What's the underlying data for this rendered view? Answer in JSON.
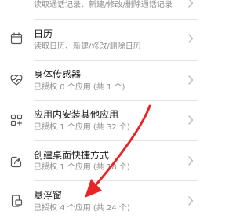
{
  "permissions": {
    "items": [
      {
        "title": "",
        "subtitle": "读取通话记录、新建/修改/删除通话记录",
        "icon": "call-log-icon"
      },
      {
        "title": "日历",
        "subtitle": "读取日历、新建/修改/删除日历",
        "icon": "calendar-icon"
      },
      {
        "title": "身体传感器",
        "subtitle": "已授权 0 个应用 (共 1 个)",
        "icon": "heartbeat-icon"
      },
      {
        "title": "应用内安装其他应用",
        "subtitle": "已授权 1 个应用 (共 32 个)",
        "icon": "install-apps-icon"
      },
      {
        "title": "创建桌面快捷方式",
        "subtitle": "已授权 1 个应用 (共 18 个)",
        "icon": "shortcut-icon"
      },
      {
        "title": "悬浮窗",
        "subtitle": "已授权 4 个应用 (共 24 个)",
        "icon": "floating-window-icon"
      }
    ]
  },
  "annotation": {
    "icon": "red-arrow-icon",
    "color": "#e8262a"
  },
  "colors": {
    "title": "#1a1a1a",
    "subtitle": "#8f8f8f",
    "icon": "#555555",
    "chevron": "#bdbdbd",
    "divider": "#e6e6e6"
  }
}
